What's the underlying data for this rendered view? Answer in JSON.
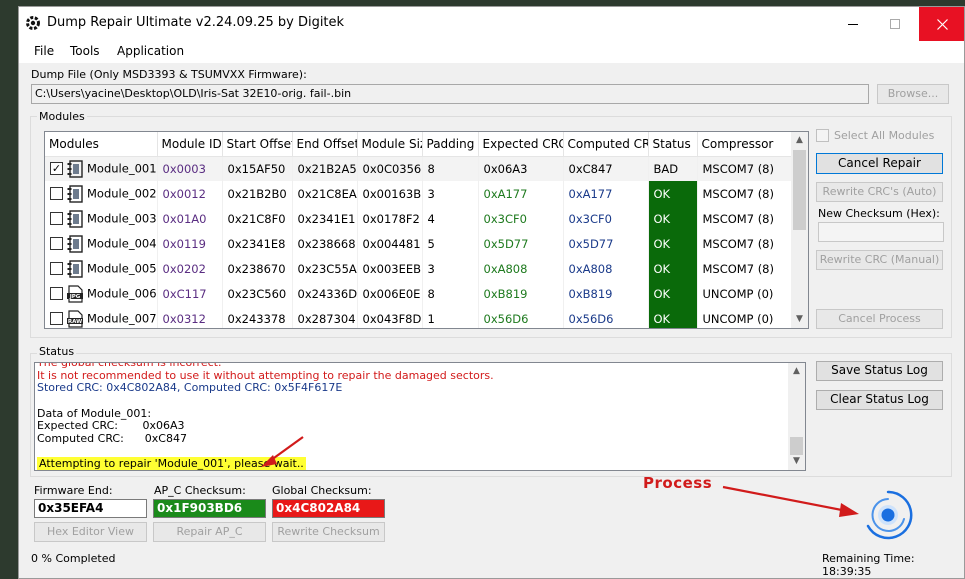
{
  "window": {
    "title": "Dump Repair Ultimate v2.24.09.25 by Digitek",
    "controls": {
      "minimize": "—",
      "maximize": "☐",
      "close": "✕"
    }
  },
  "menu": [
    "File",
    "Tools",
    "Application"
  ],
  "dump_file": {
    "label": "Dump File (Only MSD3393 & TSUMVXX Firmware):",
    "path": "C:\\Users\\yacine\\Desktop\\OLD\\Iris-Sat 32E10-orig. fail-.bin",
    "browse_label": "Browse..."
  },
  "modules": {
    "group_label": "Modules",
    "columns": [
      "Modules",
      "Module ID",
      "Start Offset",
      "End Offset",
      "Module Size",
      "Padding",
      "Expected CRC",
      "Computed CRC",
      "Status",
      "Compressor"
    ],
    "rows": [
      {
        "checked": true,
        "icon": "chip-icon",
        "name": "Module_001",
        "id": "0x0003",
        "start": "0x15AF50",
        "end": "0x21B2A5",
        "size": "0x0C0356",
        "padding": "8",
        "expected": "0x06A3",
        "computed": "0xC847",
        "status": "BAD",
        "compressor": "MSCOM7 (8)"
      },
      {
        "checked": false,
        "icon": "chip-icon",
        "name": "Module_002",
        "id": "0x0012",
        "start": "0x21B2B0",
        "end": "0x21C8EA",
        "size": "0x00163B",
        "padding": "3",
        "expected": "0xA177",
        "computed": "0xA177",
        "status": "OK",
        "compressor": "MSCOM7 (8)"
      },
      {
        "checked": false,
        "icon": "chip-icon",
        "name": "Module_003",
        "id": "0x01A0",
        "start": "0x21C8F0",
        "end": "0x2341E1",
        "size": "0x0178F2",
        "padding": "4",
        "expected": "0x3CF0",
        "computed": "0x3CF0",
        "status": "OK",
        "compressor": "MSCOM7 (8)"
      },
      {
        "checked": false,
        "icon": "chip-icon",
        "name": "Module_004",
        "id": "0x0119",
        "start": "0x2341E8",
        "end": "0x238668",
        "size": "0x004481",
        "padding": "5",
        "expected": "0x5D77",
        "computed": "0x5D77",
        "status": "OK",
        "compressor": "MSCOM7 (8)"
      },
      {
        "checked": false,
        "icon": "chip-icon",
        "name": "Module_005",
        "id": "0x0202",
        "start": "0x238670",
        "end": "0x23C55A",
        "size": "0x003EEB",
        "padding": "3",
        "expected": "0xA808",
        "computed": "0xA808",
        "status": "OK",
        "compressor": "MSCOM7 (8)"
      },
      {
        "checked": false,
        "icon": "jpg-icon",
        "name": "Module_006",
        "id": "0xC117",
        "start": "0x23C560",
        "end": "0x24336D",
        "size": "0x006E0E",
        "padding": "8",
        "expected": "0xB819",
        "computed": "0xB819",
        "status": "OK",
        "compressor": "UNCOMP (0)"
      },
      {
        "checked": false,
        "icon": "raw-icon",
        "name": "Module_007",
        "id": "0x0312",
        "start": "0x243378",
        "end": "0x287304",
        "size": "0x043F8D",
        "padding": "1",
        "expected": "0x56D6",
        "computed": "0x56D6",
        "status": "OK",
        "compressor": "UNCOMP (0)"
      }
    ],
    "icon_text": {
      "jpg": "JPG",
      "raw": "RAW"
    }
  },
  "side_panel": {
    "select_all_label": "Select All Modules",
    "cancel_repair_label": "Cancel Repair",
    "rewrite_auto_label": "Rewrite CRC's (Auto)",
    "new_checksum_label": "New Checksum (Hex):",
    "new_checksum_value": "",
    "rewrite_manual_label": "Rewrite CRC (Manual)",
    "cancel_process_label": "Cancel Process"
  },
  "status": {
    "group_label": "Status",
    "lines": [
      {
        "text": "The global checksum is incorrect.",
        "color": "#d21a1a"
      },
      {
        "text": "It is not recommended to use it without attempting to repair the damaged sectors.",
        "color": "#d21a1a"
      },
      {
        "text": "Stored CRC: 0x4C802A84, Computed CRC: 0x5F4F617E",
        "color": "#1a3a8a"
      },
      {
        "text": "",
        "color": "#000000"
      },
      {
        "text": "Data of Module_001:",
        "color": "#000000"
      },
      {
        "text": "Expected CRC:       0x06A3",
        "color": "#000000"
      },
      {
        "text": "Computed CRC:      0xC847",
        "color": "#000000"
      }
    ],
    "highlight_line": "Attempting to repair 'Module_001', please wait..",
    "save_log_label": "Save Status Log",
    "clear_log_label": "Clear Status Log"
  },
  "fields": {
    "firmware_end": {
      "label": "Firmware End:",
      "value": "0x35EFA4"
    },
    "apc_checksum": {
      "label": "AP_C Checksum:",
      "value": "0x1F903BD6",
      "bg": "#1a8a1a"
    },
    "global_checksum": {
      "label": "Global Checksum:",
      "value": "0x4C802A84",
      "bg": "#e81818"
    }
  },
  "bottom_buttons": {
    "hex_editor": "Hex Editor View",
    "repair_apc": "Repair AP_C",
    "rewrite_checksum": "Rewrite Checksum"
  },
  "annotation": {
    "process_label": "Process"
  },
  "footer": {
    "completed": "0 % Completed",
    "remaining": "Remaining Time: 18:39:35",
    "progress_fraction": 0.0
  },
  "colors": {
    "ok_bg": "#0a6a0a",
    "annotation_red": "#d11b1b",
    "spinner_blue": "#1a6fe0"
  }
}
